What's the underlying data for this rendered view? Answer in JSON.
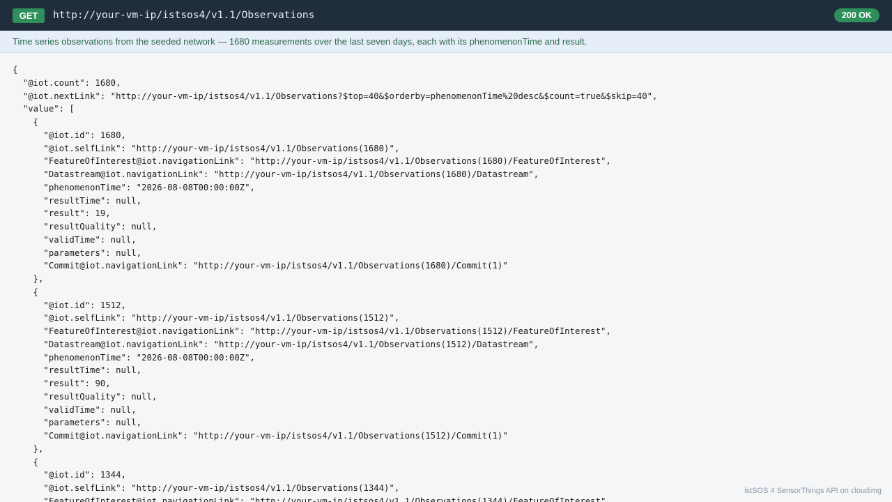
{
  "request": {
    "method": "GET",
    "url": "http://your-vm-ip/istsos4/v1.1/Observations",
    "status": "200 OK"
  },
  "banner": {
    "text": "Time series observations from the seeded network — 1680 measurements over the last seven days, each with its phenomenonTime and result."
  },
  "response": {
    "lines": [
      "{",
      "  \"@iot.count\": 1680,",
      "  \"@iot.nextLink\": \"http://your-vm-ip/istsos4/v1.1/Observations?$top=40&$orderby=phenomenonTime%20desc&$count=true&$skip=40\",",
      "  \"value\": [",
      "    {",
      "      \"@iot.id\": 1680,",
      "      \"@iot.selfLink\": \"http://your-vm-ip/istsos4/v1.1/Observations(1680)\",",
      "      \"FeatureOfInterest@iot.navigationLink\": \"http://your-vm-ip/istsos4/v1.1/Observations(1680)/FeatureOfInterest\",",
      "      \"Datastream@iot.navigationLink\": \"http://your-vm-ip/istsos4/v1.1/Observations(1680)/Datastream\",",
      "      \"phenomenonTime\": \"2026-08-08T00:00:00Z\",",
      "      \"resultTime\": null,",
      "      \"result\": 19,",
      "      \"resultQuality\": null,",
      "      \"validTime\": null,",
      "      \"parameters\": null,",
      "      \"Commit@iot.navigationLink\": \"http://your-vm-ip/istsos4/v1.1/Observations(1680)/Commit(1)\"",
      "    },",
      "    {",
      "      \"@iot.id\": 1512,",
      "      \"@iot.selfLink\": \"http://your-vm-ip/istsos4/v1.1/Observations(1512)\",",
      "      \"FeatureOfInterest@iot.navigationLink\": \"http://your-vm-ip/istsos4/v1.1/Observations(1512)/FeatureOfInterest\",",
      "      \"Datastream@iot.navigationLink\": \"http://your-vm-ip/istsos4/v1.1/Observations(1512)/Datastream\",",
      "      \"phenomenonTime\": \"2026-08-08T00:00:00Z\",",
      "      \"resultTime\": null,",
      "      \"result\": 90,",
      "      \"resultQuality\": null,",
      "      \"validTime\": null,",
      "      \"parameters\": null,",
      "      \"Commit@iot.navigationLink\": \"http://your-vm-ip/istsos4/v1.1/Observations(1512)/Commit(1)\"",
      "    },",
      "    {",
      "      \"@iot.id\": 1344,",
      "      \"@iot.selfLink\": \"http://your-vm-ip/istsos4/v1.1/Observations(1344)\",",
      "      \"FeatureOfInterest@iot.navigationLink\": \"http://your-vm-ip/istsos4/v1.1/Observations(1344)/FeatureOfInterest\","
    ]
  },
  "footer": {
    "text": "istSOS 4 SensorThings API on cloudimg"
  }
}
